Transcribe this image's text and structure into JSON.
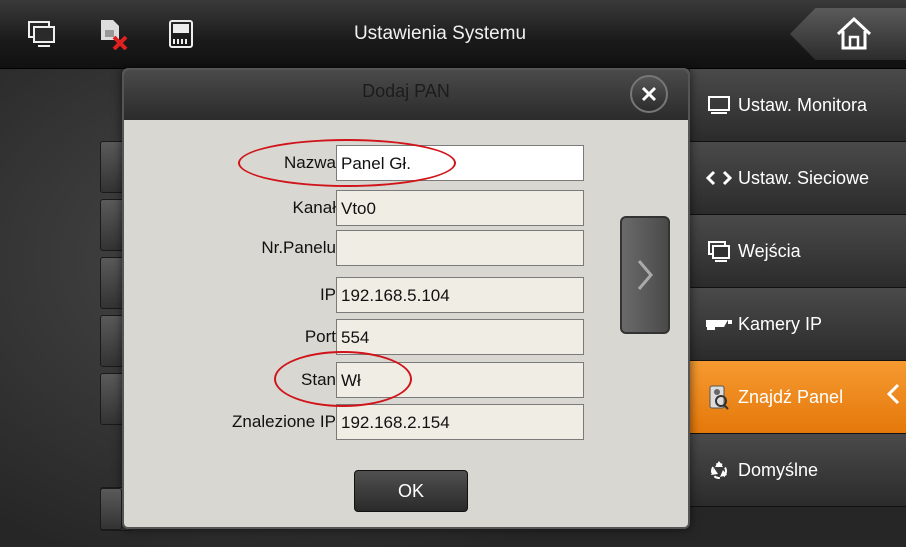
{
  "topbar": {
    "title": "Ustawienia Systemu",
    "icons": [
      "network-icon",
      "sim-card-error-icon",
      "sd-card-icon"
    ],
    "home_icon": "home-icon"
  },
  "menu": {
    "items": [
      {
        "label": "Ustaw. Monitora",
        "icon": "monitor-icon"
      },
      {
        "label": "Ustaw. Sieciowe",
        "icon": "network-arrows-icon"
      },
      {
        "label": "Wejścia",
        "icon": "inputs-icon"
      },
      {
        "label": "Kamery IP",
        "icon": "ip-camera-icon"
      },
      {
        "label": "Znajdź Panel",
        "icon": "find-panel-icon",
        "active": true
      },
      {
        "label": "Domyślne",
        "icon": "recycle-icon"
      }
    ],
    "active_color": "#F08A1C"
  },
  "dialog": {
    "title": "Dodaj PAN",
    "fields": [
      {
        "label": "Nazwa",
        "value": "Panel Gł."
      },
      {
        "label": "Kanał",
        "value": "Vto0"
      },
      {
        "label": "Nr.Panelu",
        "value": ""
      },
      {
        "label": "IP",
        "value": "192.168.5.104"
      },
      {
        "label": "Port",
        "value": "554"
      },
      {
        "label": "Stan",
        "value": "Wł"
      },
      {
        "label": "Znalezione IP",
        "value": "192.168.2.154"
      }
    ],
    "ok_label": "OK"
  },
  "highlight_color": "#D0141A"
}
